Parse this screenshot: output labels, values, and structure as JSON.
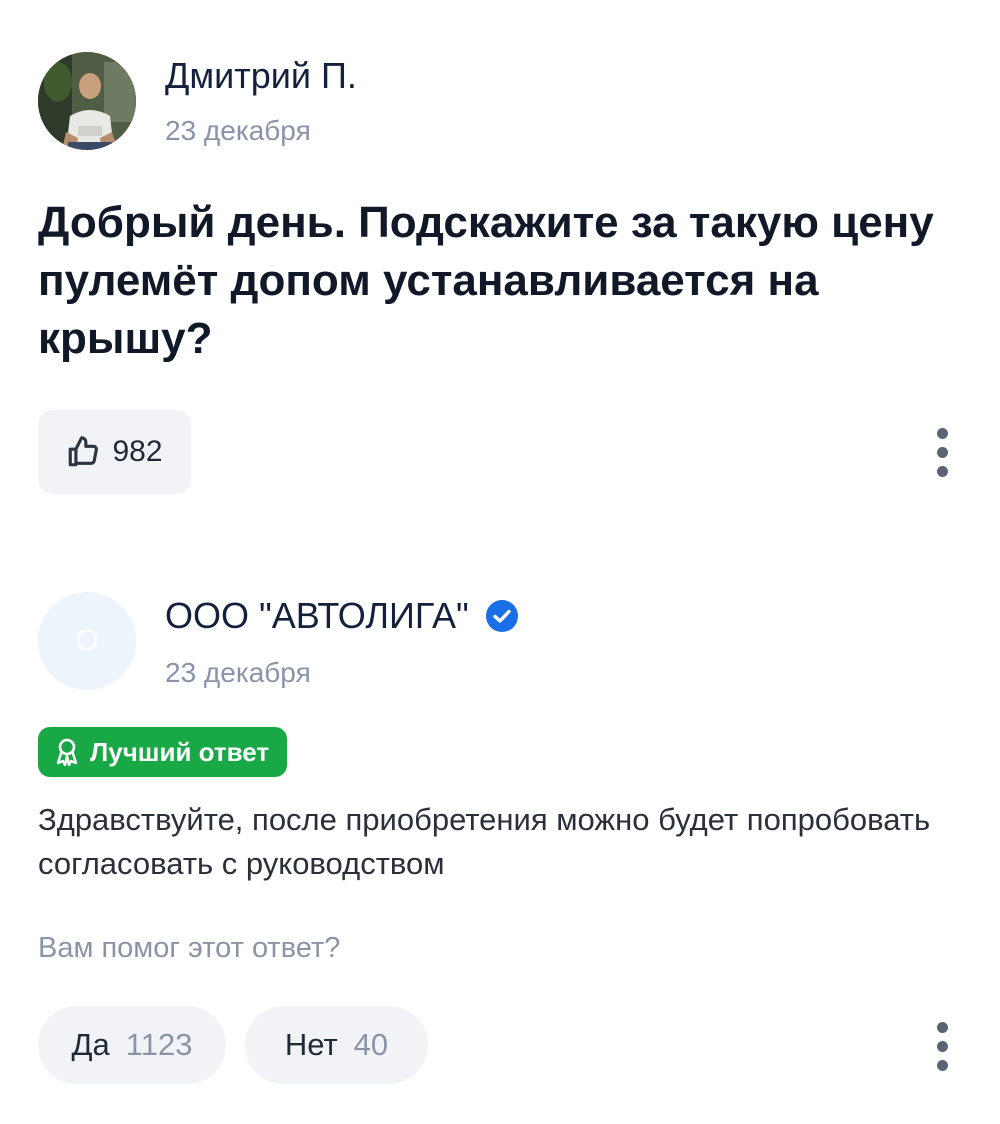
{
  "question": {
    "author_name": "Дмитрий П.",
    "date": "23 декабря",
    "text": "Добрый день. Подскажите за такую цену пулемёт допом устанавливается на крышу?",
    "likes": "982",
    "icons": {
      "like": "thumbs-up-icon",
      "more": "more-vertical-icon"
    }
  },
  "answer": {
    "avatar_letter": "О",
    "company_name": "ООО \"АВТОЛИГА\"",
    "verified_icon": "verified-check-icon",
    "date": "23 декабря",
    "badge_label": "Лучший ответ",
    "badge_icon": "award-icon",
    "text": "Здравствуйте, после приобретения можно будет попробовать согласовать с руководством",
    "helpful_question": "Вам помог этот ответ?",
    "votes": {
      "yes_label": "Да",
      "yes_count": "1123",
      "no_label": "Нет",
      "no_count": "40"
    }
  },
  "colors": {
    "accent_green": "#18a846",
    "verified_blue": "#1a6ee8",
    "muted_text": "#8a94a6",
    "chip_bg": "#f1f3f6"
  }
}
